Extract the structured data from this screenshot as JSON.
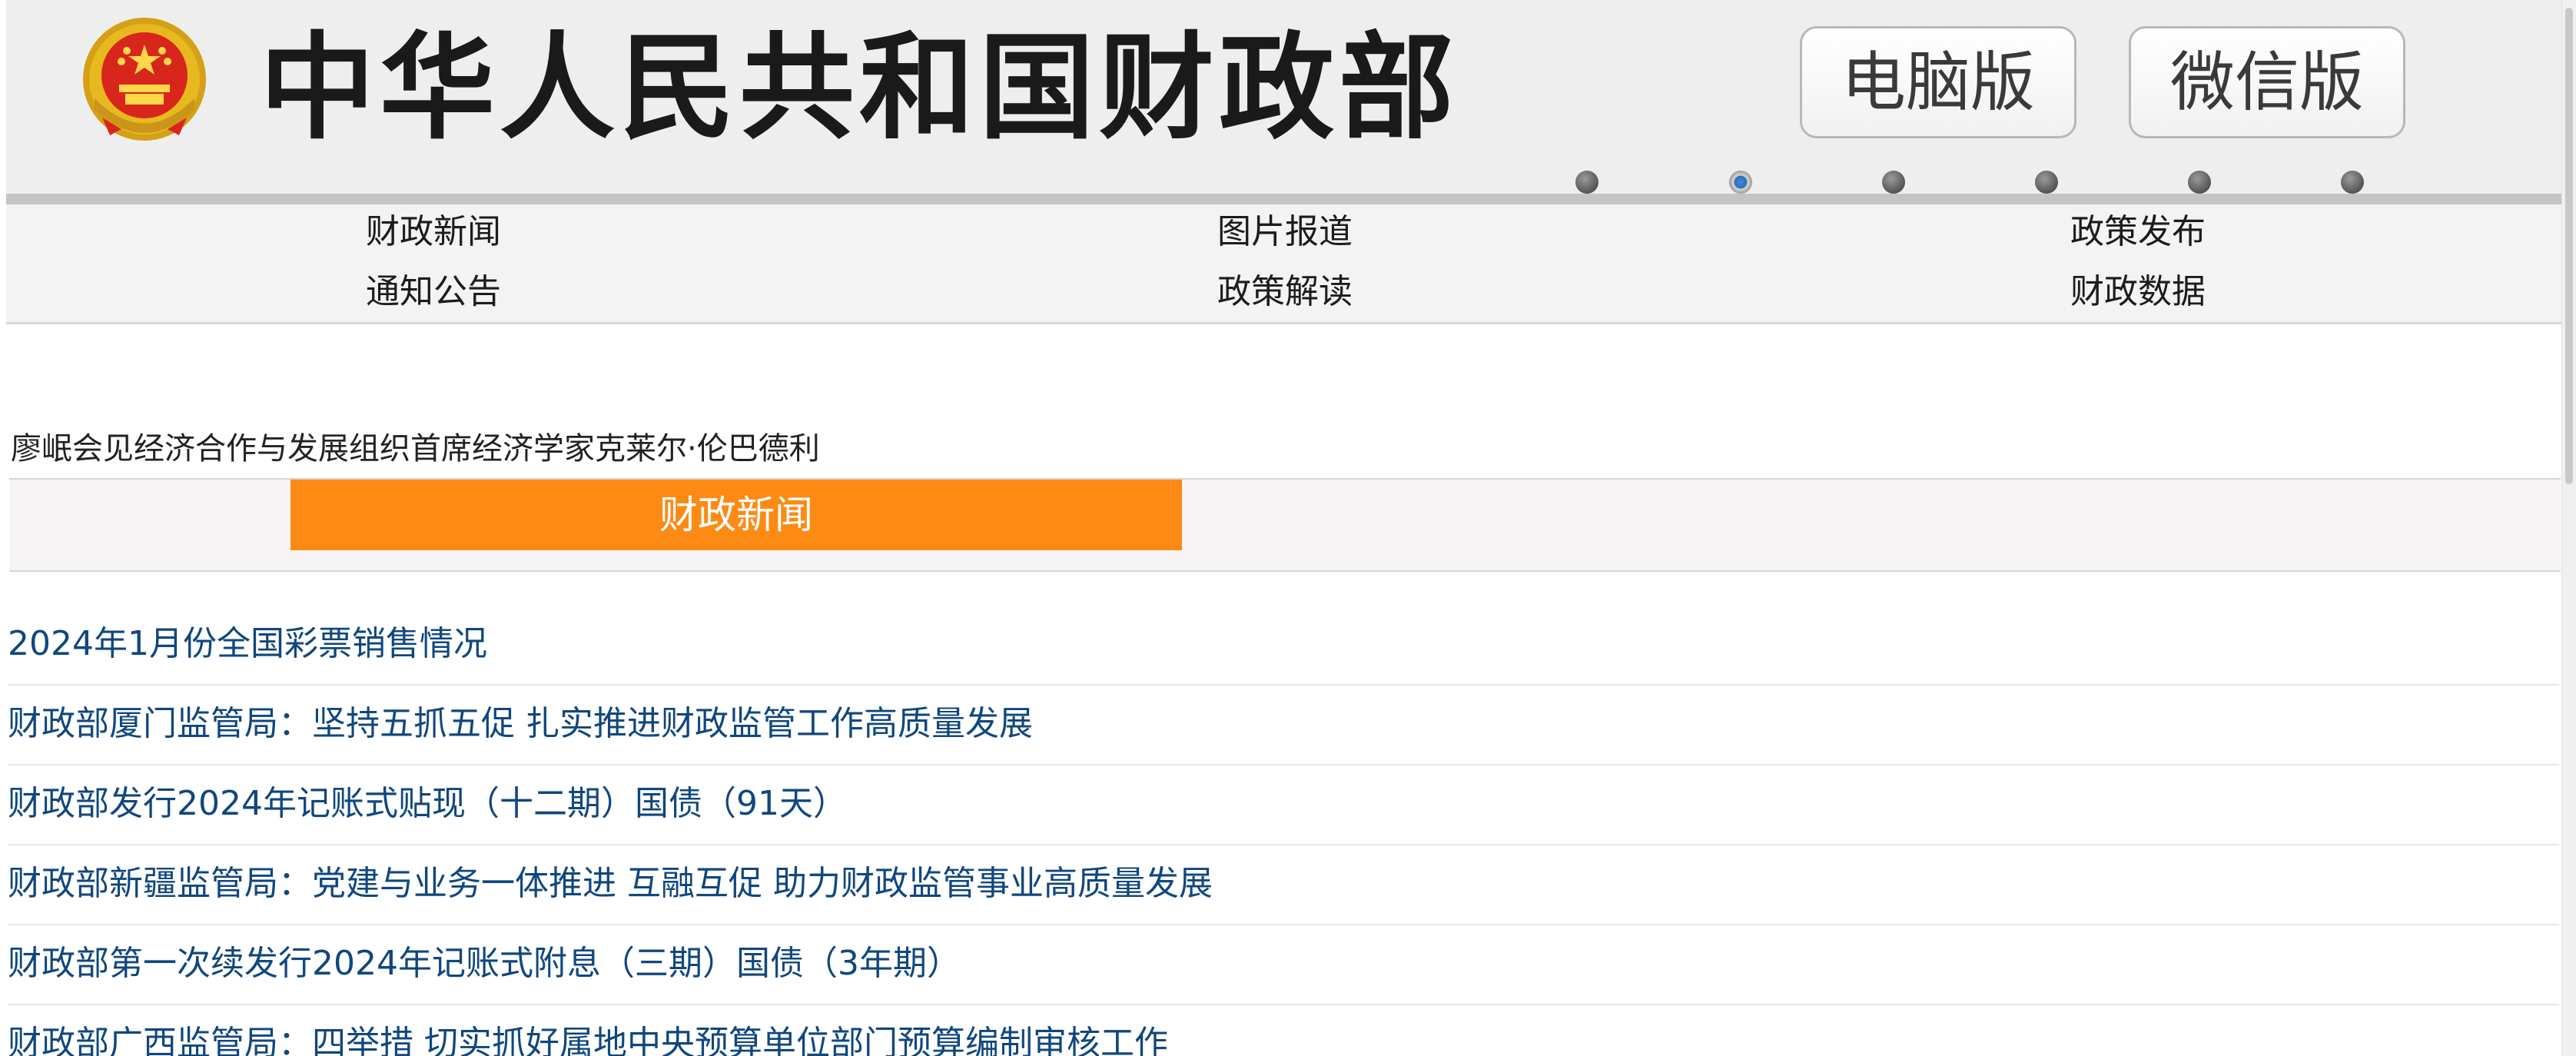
{
  "header": {
    "title": "中华人民共和国财政部",
    "emblem_icon": "national-emblem-icon",
    "version_buttons": [
      {
        "label": "电脑版"
      },
      {
        "label": "微信版"
      }
    ],
    "carousel": {
      "dot_count": 6,
      "active_index": 1,
      "active_color": "#2a6fb5"
    }
  },
  "nav": {
    "items": [
      {
        "label": "财政新闻"
      },
      {
        "label": "图片报道"
      },
      {
        "label": "政策发布"
      },
      {
        "label": "通知公告"
      },
      {
        "label": "政策解读"
      },
      {
        "label": "财政数据"
      }
    ]
  },
  "headline": {
    "text": "廖岷会见经济合作与发展组织首席经济学家克莱尔·伦巴德利"
  },
  "section": {
    "tab_label": "财政新闻",
    "tab_color": "#fd8a14"
  },
  "news": {
    "link_color": "#10477e",
    "items": [
      {
        "title": "2024年1月份全国彩票销售情况"
      },
      {
        "title": "财政部厦门监管局：坚持五抓五促 扎实推进财政监管工作高质量发展"
      },
      {
        "title": "财政部发行2024年记账式贴现（十二期）国债（91天）"
      },
      {
        "title": "财政部新疆监管局：党建与业务一体推进 互融互促 助力财政监管事业高质量发展"
      },
      {
        "title": "财政部第一次续发行2024年记账式附息（三期）国债（3年期）"
      },
      {
        "title": "财政部广西监管局：四举措 切实抓好属地中央预算单位部门预算编制审核工作"
      }
    ]
  }
}
